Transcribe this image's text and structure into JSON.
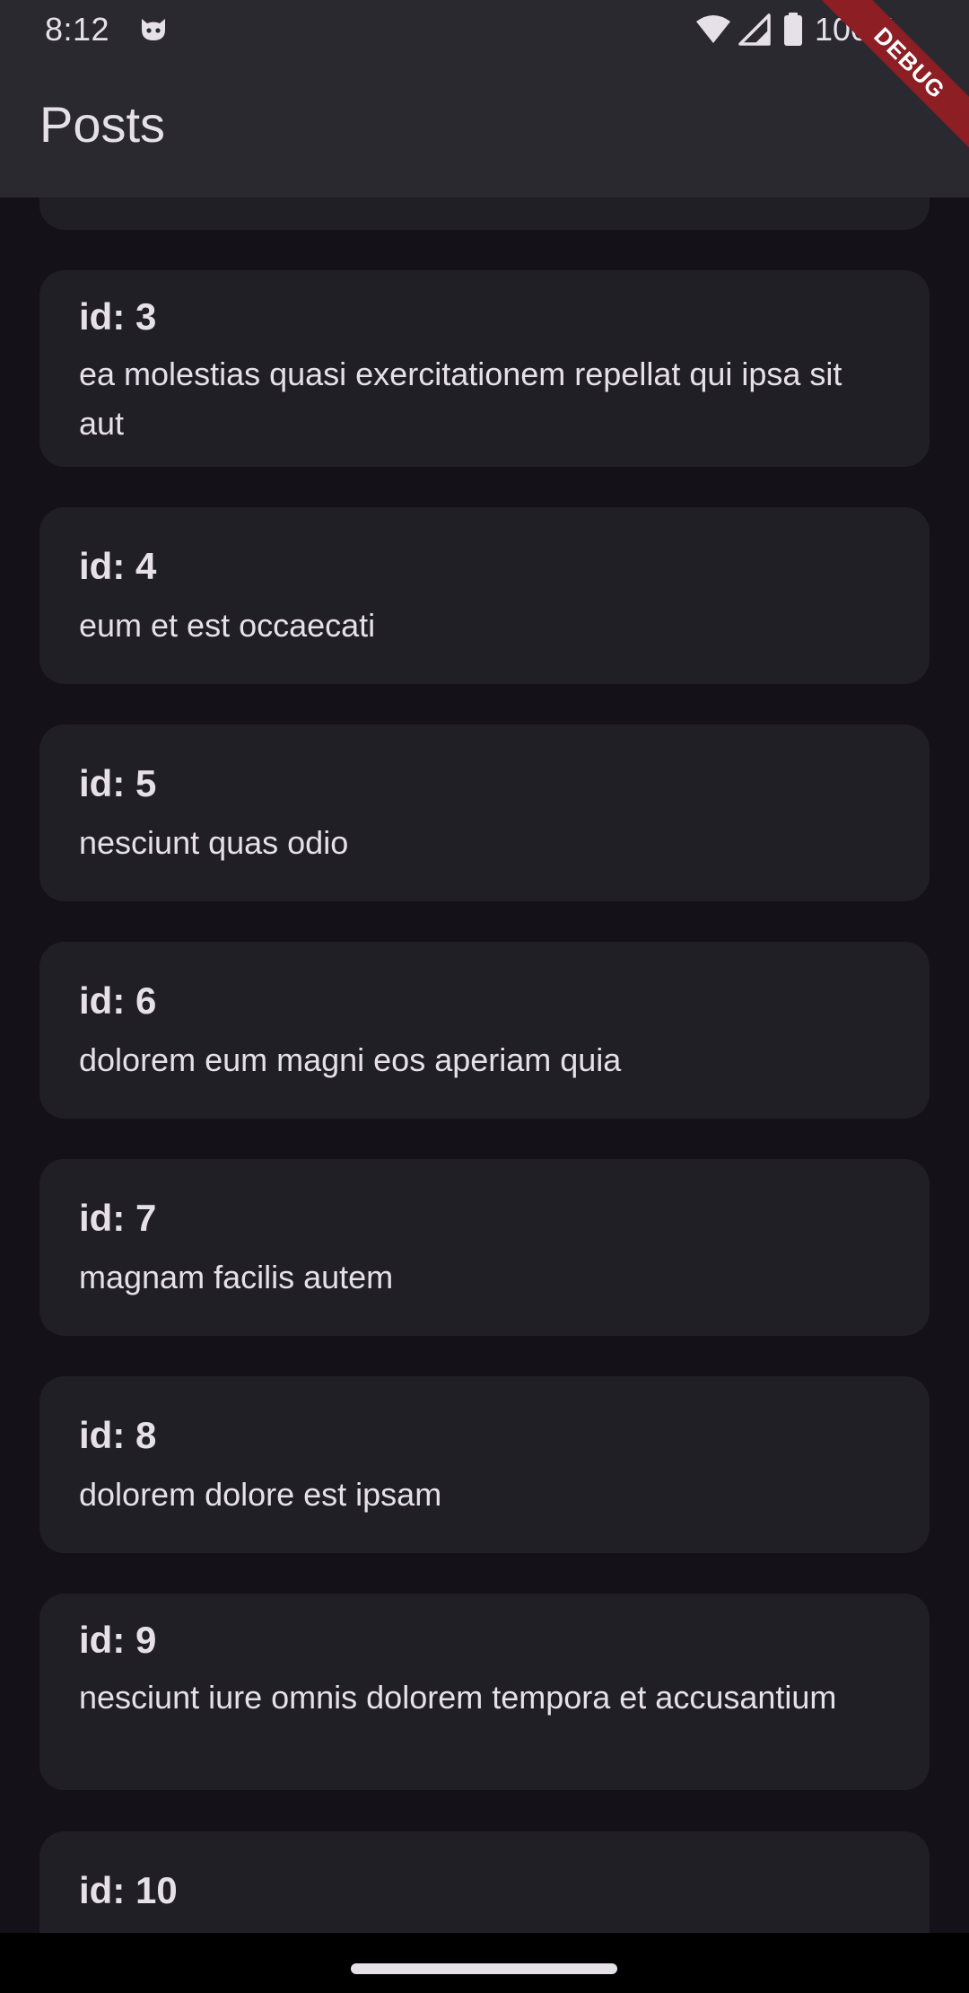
{
  "status_bar": {
    "time": "8:12",
    "battery_text": "100%",
    "icons": [
      "cat-notification-icon",
      "wifi-icon",
      "cell-signal-icon",
      "battery-icon"
    ]
  },
  "app_bar": {
    "title": "Posts"
  },
  "debug_banner": {
    "label": "DEBUG"
  },
  "posts": [
    {
      "id_label": "",
      "title": ""
    },
    {
      "id_label": "id: 3",
      "title": "ea molestias quasi exercitationem repellat qui ipsa sit aut"
    },
    {
      "id_label": "id: 4",
      "title": "eum et est occaecati"
    },
    {
      "id_label": "id: 5",
      "title": "nesciunt quas odio"
    },
    {
      "id_label": "id: 6",
      "title": "dolorem eum magni eos aperiam quia"
    },
    {
      "id_label": "id: 7",
      "title": "magnam facilis autem"
    },
    {
      "id_label": "id: 8",
      "title": "dolorem dolore est ipsam"
    },
    {
      "id_label": "id: 9",
      "title": "nesciunt iure omnis dolorem tempora et accusantium"
    },
    {
      "id_label": "id: 10",
      "title": ""
    }
  ],
  "colors": {
    "background": "#141218",
    "app_bar": "#2b2930",
    "card": "#211f26",
    "text": "#e6e0e9",
    "debug_banner": "#8d1e24"
  }
}
